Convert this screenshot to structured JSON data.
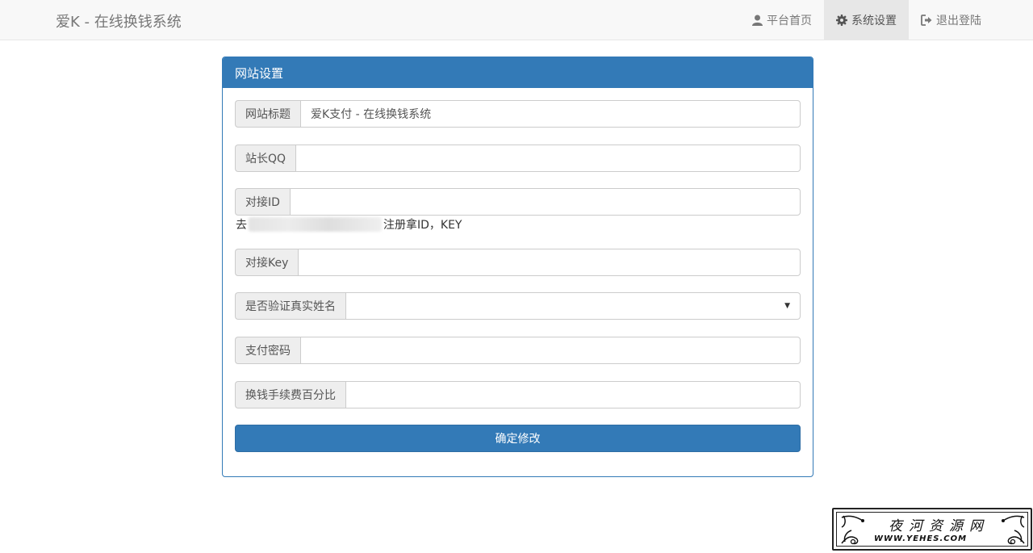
{
  "navbar": {
    "brand": "爱K - 在线换钱系统",
    "items": [
      {
        "label": "平台首页",
        "icon": "user-icon"
      },
      {
        "label": "系统设置",
        "icon": "gear-icon",
        "active": true
      },
      {
        "label": "退出登陆",
        "icon": "sign-out-icon"
      }
    ]
  },
  "panel": {
    "heading": "网站设置",
    "fields": [
      {
        "label": "网站标题",
        "value": "爱K支付 - 在线换钱系统"
      },
      {
        "label": "站长QQ",
        "value": ""
      },
      {
        "label": "对接ID",
        "value": ""
      },
      {
        "label": "对接Key",
        "value": ""
      },
      {
        "label": "是否验证真实姓名",
        "value": ""
      },
      {
        "label": "支付密码",
        "value": ""
      },
      {
        "label": "换钱手续费百分比",
        "value": ""
      }
    ],
    "help_prefix": "去",
    "help_suffix": "注册拿ID，KEY",
    "submit": "确定修改"
  },
  "watermark": {
    "title": "夜河资源网",
    "url": "WWW.YEHES.COM"
  },
  "colors": {
    "primary": "#337ab7",
    "navbar_bg": "#f8f8f8",
    "active_nav_bg": "#e7e7e7",
    "addon_bg": "#eeeeee"
  }
}
